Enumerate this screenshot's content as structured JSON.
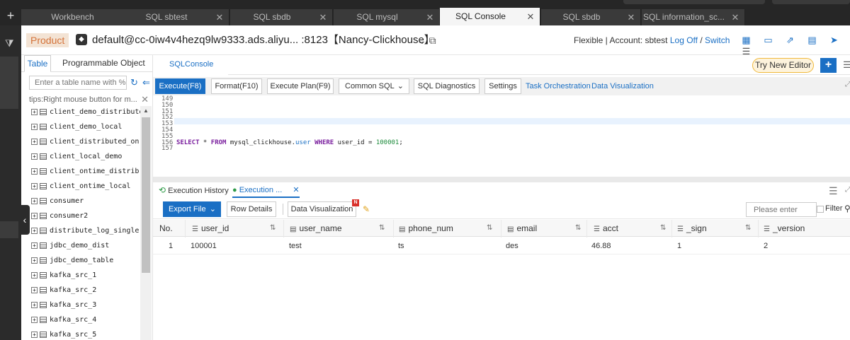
{
  "tabs": [
    {
      "label": "Workbench",
      "closable": false
    },
    {
      "label": "SQL sbtest",
      "closable": true
    },
    {
      "label": "SQL sbdb",
      "closable": true
    },
    {
      "label": "SQL mysql",
      "closable": true
    },
    {
      "label": "SQL Console",
      "closable": true,
      "active": true
    },
    {
      "label": "SQL sbdb",
      "closable": true
    },
    {
      "label": "SQL information_sc...",
      "closable": true
    }
  ],
  "header": {
    "product": "Product",
    "connection": "default@cc-0iw4v4hezq9lw9333.ads.aliyu... :8123【Nancy-Clickhouse】",
    "mode_account": "Flexible | Account: sbtest",
    "logoff": "Log Off",
    "slash": "/",
    "switch": "Switch"
  },
  "left_panel": {
    "tabs": [
      "Table",
      "Programmable Object"
    ],
    "search_placeholder": "Enter a table name with % t",
    "tips": "tips:Right mouse button for m...",
    "tables": [
      "client_demo_distributed",
      "client_demo_local",
      "client_distributed_on···",
      "client_local_demo",
      "client_ontime_distrib···",
      "client_ontime_local",
      "consumer",
      "consumer2",
      "distribute_log_single···",
      "jdbc_demo_dist",
      "jdbc_demo_table",
      "kafka_src_1",
      "kafka_src_2",
      "kafka_src_3",
      "kafka_src_4",
      "kafka_src_5"
    ]
  },
  "console": {
    "tab_label": "SQLConsole",
    "try_new_editor": "Try New Editor",
    "toolbar": {
      "execute": "Execute(F8)",
      "format": "Format(F10)",
      "execute_plan": "Execute Plan(F9)",
      "common_sql": "Common SQL",
      "diagnostics": "SQL Diagnostics",
      "settings": "Settings",
      "task_orchestration": "Task Orchestration",
      "data_visualization": "Data Visualization"
    },
    "line_numbers": [
      "149",
      "150",
      "151",
      "152",
      "153",
      "154",
      "155",
      "156",
      "157"
    ],
    "sql": {
      "select": "SELECT",
      "star": " * ",
      "from": "FROM",
      "db": " mysql_clickhouse.",
      "table": "user",
      "where": " WHERE",
      "cond": " user_id = ",
      "value": "100001",
      "end": ";"
    }
  },
  "results": {
    "history_tab": "Execution History",
    "exec_tab": "Execution ...",
    "export": "Export File",
    "row_details": "Row Details",
    "data_visualization": "Data Visualization",
    "new_badge": "N",
    "search_placeholder": "Please enter",
    "filter": "Filter",
    "columns": [
      "No.",
      "user_id",
      "user_name",
      "phone_num",
      "email",
      "acct",
      "_sign",
      "_version"
    ],
    "rows": [
      [
        "1",
        "100001",
        "test",
        "ts",
        "des",
        "46.88",
        "1",
        "2"
      ]
    ]
  },
  "colors": {
    "accent": "#1a6fc4",
    "product_bg": "#f3e3d4",
    "product_fg": "#d4733a",
    "success": "#2e9a47"
  }
}
